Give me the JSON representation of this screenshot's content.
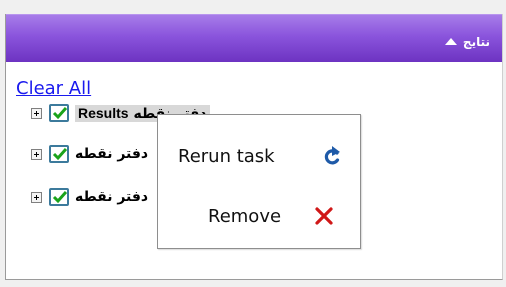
{
  "header": {
    "title": "نتایج"
  },
  "actions": {
    "clear_all": "Clear All"
  },
  "tree": {
    "rows": [
      {
        "label": "دفتر نقطه",
        "suffix": "Results",
        "checked": true,
        "selected": true
      },
      {
        "label": "دفتر نقطه",
        "suffix": "",
        "checked": true,
        "selected": false
      },
      {
        "label": "دفتر نقطه",
        "suffix": "",
        "checked": true,
        "selected": false
      }
    ]
  },
  "context_menu": {
    "items": [
      {
        "label": "Rerun task",
        "icon": "refresh-icon"
      },
      {
        "label": "Remove",
        "icon": "remove-x-icon"
      }
    ]
  },
  "colors": {
    "header_top": "#a77ce9",
    "header_bottom": "#6d33c2",
    "link": "#1a1aee",
    "check": "#1aa31a",
    "refresh": "#1e5aa8",
    "remove": "#d01818"
  }
}
